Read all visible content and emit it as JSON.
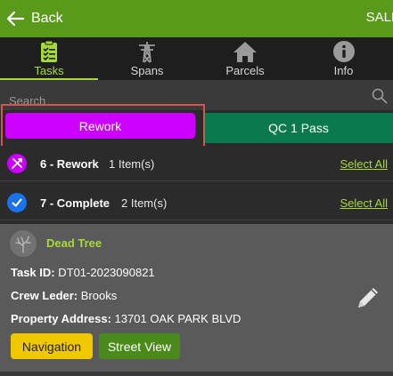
{
  "header": {
    "back_label": "Back",
    "right_text": "SALE",
    "color": "#5a9a1a"
  },
  "tabs": [
    {
      "label": "Tasks",
      "icon": "clipboard-checklist-icon",
      "active": true
    },
    {
      "label": "Spans",
      "icon": "power-tower-icon",
      "active": false
    },
    {
      "label": "Parcels",
      "icon": "house-icon",
      "active": false
    },
    {
      "label": "Info",
      "icon": "info-icon",
      "active": false
    }
  ],
  "search": {
    "placeholder": "Search",
    "value": ""
  },
  "filters": {
    "rework_label": "Rework",
    "qc_label": "QC 1 Pass",
    "rework_color": "#cc00ff",
    "qc_color": "#0a7a4e",
    "highlight_color": "#d9534f"
  },
  "groups": [
    {
      "title": "6 - Rework",
      "count": "1 Item(s)",
      "select_all": "Select All",
      "icon": "tools-icon",
      "icon_color": "#cc00ff"
    },
    {
      "title": "7 - Complete",
      "count": "2 Item(s)",
      "select_all": "Select All",
      "icon": "check-circle-icon",
      "icon_color": "#1a73e8"
    }
  ],
  "card": {
    "title": "Dead Tree",
    "icon": "dead-tree-icon",
    "task_id_label": "Task ID:",
    "task_id": "DT01-2023090821",
    "crew_label": "Crew Leder:",
    "crew": "Brooks",
    "address_label": "Property Address:",
    "address": "13701 OAK PARK BLVD",
    "navigation_label": "Navigation",
    "street_view_label": "Street View",
    "navigation_color": "#f0c800",
    "street_view_color": "#4a8a1a"
  }
}
